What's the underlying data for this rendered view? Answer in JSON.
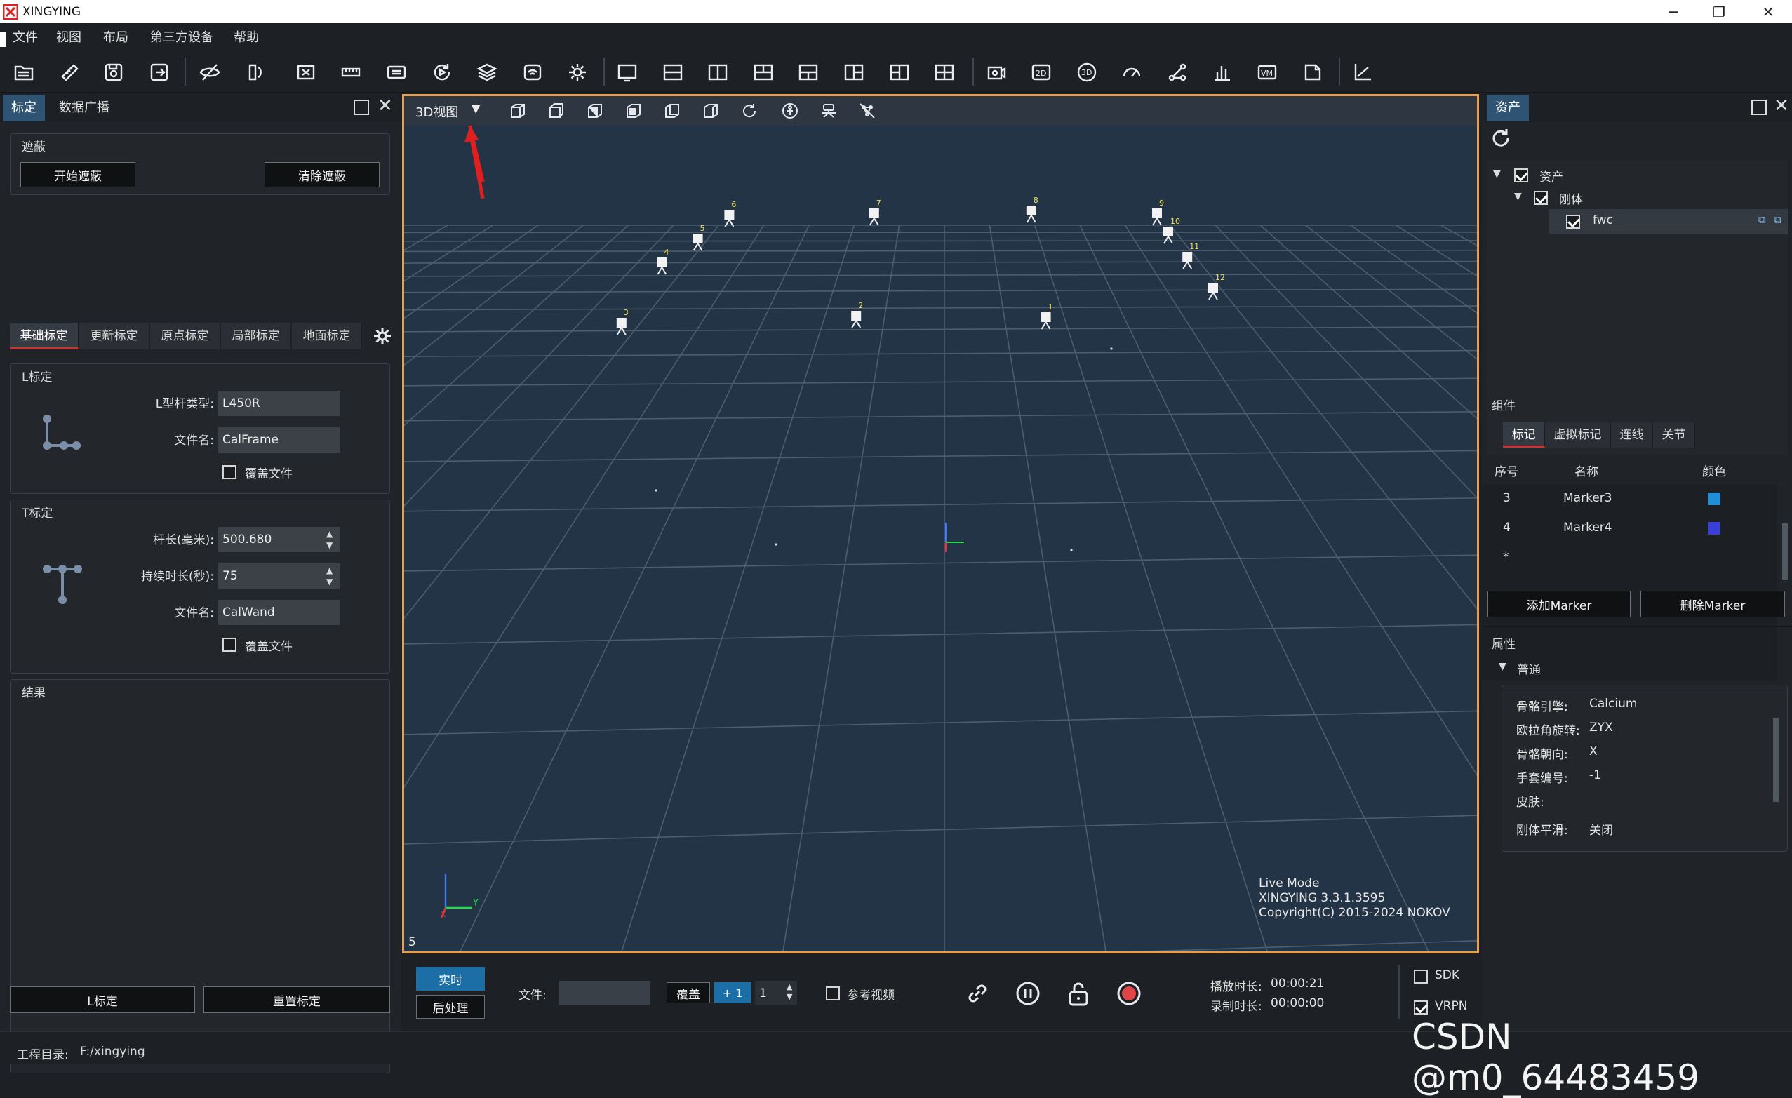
{
  "app": {
    "title": "XINGYING"
  },
  "window_controls": {
    "minimize": "─",
    "restore": "❐",
    "close": "✕"
  },
  "menu": [
    "文件",
    "视图",
    "布局",
    "第三方设备",
    "帮助"
  ],
  "toolbar_icons": [
    "open-folder-icon",
    "ruler-icon",
    "save-icon",
    "save-as-icon",
    "hide-icon",
    "sync-icon",
    "video-off-icon",
    "ruler-2-icon",
    "video-icon",
    "replay-icon",
    "layers-icon",
    "broadcast-icon",
    "gear-icon",
    "layout-1-icon",
    "layout-2-icon",
    "layout-3-icon",
    "layout-4-icon",
    "layout-5-icon",
    "layout-6-icon",
    "layout-7-icon",
    "layout-8-icon",
    "camera-capture-icon",
    "view-2d-icon",
    "view-3d-icon",
    "gauge-icon",
    "skeleton-icon",
    "bar-chart-icon",
    "vm-icon",
    "export-icon",
    "axis-icon"
  ],
  "left_panel": {
    "tabs": [
      "标定",
      "数据广播"
    ],
    "mask_group": {
      "title": "遮蔽",
      "start_btn": "开始遮蔽",
      "clear_btn": "清除遮蔽"
    },
    "sub_tabs": [
      "基础标定",
      "更新标定",
      "原点标定",
      "局部标定",
      "地面标定"
    ],
    "l_calib": {
      "title": "L标定",
      "type_label": "L型杆类型:",
      "type_value": "L450R",
      "file_label": "文件名:",
      "file_value": "CalFrame",
      "overwrite_label": "覆盖文件"
    },
    "t_calib": {
      "title": "T标定",
      "length_label": "杆长(毫米):",
      "length_value": "500.680",
      "duration_label": "持续时长(秒):",
      "duration_value": "75",
      "file_label": "文件名:",
      "file_value": "CalWand",
      "overwrite_label": "覆盖文件"
    },
    "result": {
      "title": "结果"
    },
    "bottom_btns": {
      "l": "L标定",
      "reset": "重置标定"
    }
  },
  "viewport": {
    "view_mode": "3D视图",
    "corner_number": "5",
    "info": [
      "Live Mode",
      "XINGYING 3.3.1.3595",
      "Copyright(C) 2015-2024 NOKOV"
    ],
    "axis_y": "Y",
    "axis_x": "X",
    "cameras": [
      "1",
      "2",
      "3",
      "4",
      "5",
      "6",
      "7",
      "8",
      "9",
      "10",
      "11",
      "12"
    ]
  },
  "bottom_bar": {
    "live_btn": "实时",
    "post_btn": "后处理",
    "file_label": "文件:",
    "file_value": "",
    "overwrite_btn": "覆盖",
    "plus_btn": "+ 1",
    "spin_value": "1",
    "ref_video_label": "参考视频",
    "play_time_label": "播放时长:",
    "play_time_value": "00:00:21",
    "rec_time_label": "录制时长:",
    "rec_time_value": "00:00:00",
    "sdk_label": "SDK",
    "vrpn_label": "VRPN"
  },
  "right_panel": {
    "tab": "资产",
    "tree": {
      "root": "资产",
      "group": "刚体",
      "item": "fwc"
    },
    "components_title": "组件",
    "comp_tabs": [
      "标记",
      "虚拟标记",
      "连线",
      "关节"
    ],
    "table_headers": [
      "序号",
      "名称",
      "颜色"
    ],
    "rows": [
      {
        "idx": "3",
        "name": "Marker3",
        "color": "#1e8fd8"
      },
      {
        "idx": "4",
        "name": "Marker4",
        "color": "#3a3fd6"
      },
      {
        "idx": "*",
        "name": "",
        "color": ""
      }
    ],
    "add_btn": "添加Marker",
    "del_btn": "删除Marker",
    "props_title": "属性",
    "props_group": "普通",
    "props": [
      {
        "k": "骨骼引擎:",
        "v": "Calcium"
      },
      {
        "k": "欧拉角旋转:",
        "v": "ZYX"
      },
      {
        "k": "骨骼朝向:",
        "v": "X"
      },
      {
        "k": "手套编号:",
        "v": "-1"
      },
      {
        "k": "皮肤:",
        "v": ""
      },
      {
        "k": "刚体平滑:",
        "v": "关闭"
      }
    ]
  },
  "status": {
    "project_label": "工程目录:",
    "project_value": "F:/xingying"
  },
  "watermark": "CSDN @m0_64483459",
  "colors": {
    "accent_orange": "#e4a04a",
    "live_blue": "#1c6fa6",
    "red_arrow": "#e02020"
  }
}
